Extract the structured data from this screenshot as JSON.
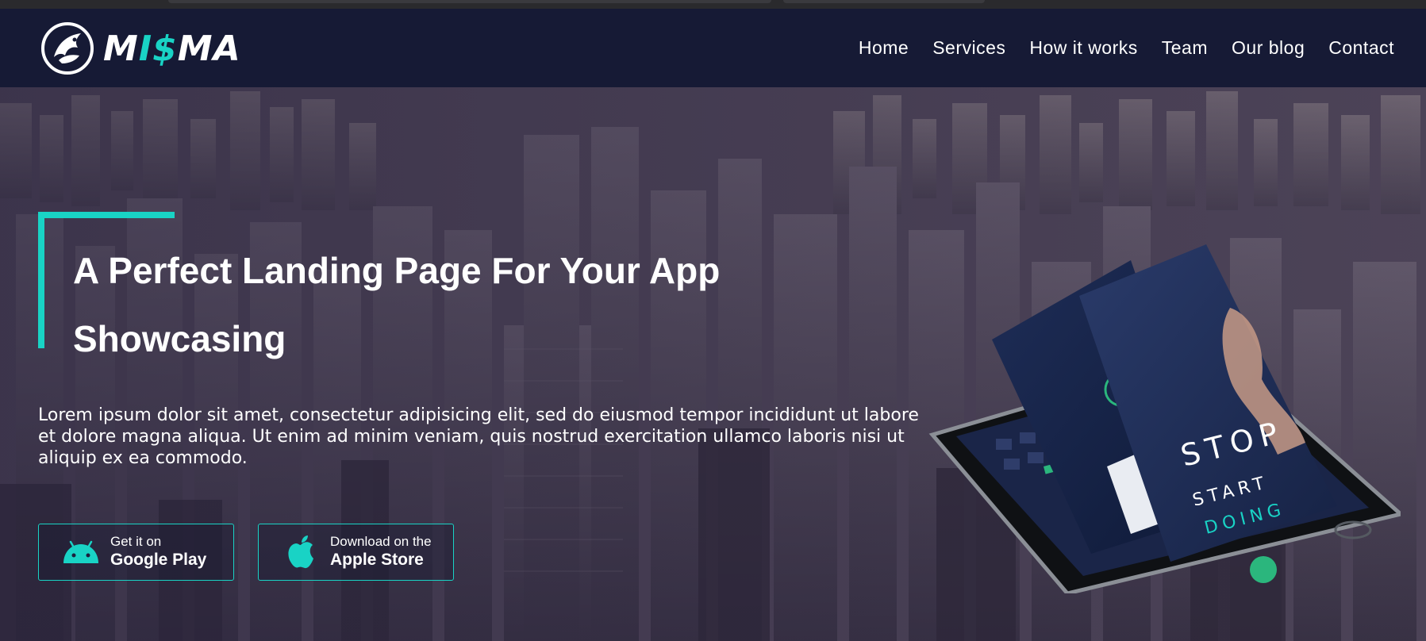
{
  "brand": {
    "logo_text_white_1": "M",
    "logo_text_teal": "I$",
    "logo_text_white_2": "MA",
    "accent_color": "#19d3c5",
    "nav_bg": "#161a35"
  },
  "nav": {
    "items": [
      {
        "label": "Home"
      },
      {
        "label": "Services"
      },
      {
        "label": "How it works"
      },
      {
        "label": "Team"
      },
      {
        "label": "Our blog"
      },
      {
        "label": "Contact"
      }
    ]
  },
  "hero": {
    "title": "A Perfect Landing Page For Your App Showcasing",
    "text": "Lorem ipsum dolor sit amet, consectetur adipisicing elit, sed do eiusmod tempor incididunt ut labore et dolore magna aliqua. Ut enim ad minim veniam, quis nostrud exercitation ullamco laboris nisi ut aliquip ex ea commodo.",
    "google_play": {
      "small": "Get it on",
      "big": "Google Play",
      "icon": "android-icon"
    },
    "apple_store": {
      "small": "Download on the",
      "big": "Apple Store",
      "icon": "apple-icon"
    },
    "mockup": {
      "screen_text_1": "STOP",
      "screen_text_2": "START",
      "screen_text_3": "DOING"
    }
  }
}
